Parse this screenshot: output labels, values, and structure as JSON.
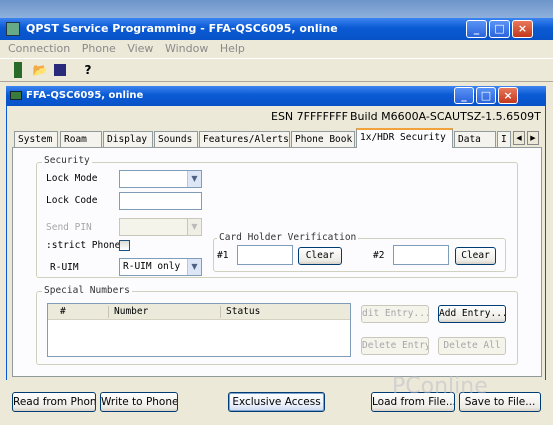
{
  "desktop": {
    "taskbar_text": ""
  },
  "window": {
    "title": "QPST Service Programming - FFA-QSC6095, online",
    "menu": [
      "Connection",
      "Phone",
      "View",
      "Window",
      "Help"
    ],
    "controls": [
      "_",
      "□",
      "×"
    ]
  },
  "inner": {
    "title": "FFA-QSC6095, online",
    "esn": "ESN 7FFFFFFF",
    "build": "Build M6600A-SCAUTSZ-1.5.6509T"
  },
  "tabs": [
    "System",
    "Roam",
    "Display",
    "Sounds",
    "Features/Alerts",
    "Phone Book",
    "1x/HDR Security",
    "Data",
    "I"
  ],
  "security": {
    "legend": "Security",
    "lock_mode_label": "Lock Mode",
    "lock_code_label": "Lock Code",
    "send_pin_label": "Send PIN",
    "restrict_phone_label": ":strict Phone",
    "ruim_label": "R-UIM",
    "ruim_value": "R-UIM only"
  },
  "card_holder": {
    "legend": "Card Holder Verification",
    "label1": "#1",
    "label2": "#2",
    "clear_label": "Clear"
  },
  "special_numbers": {
    "legend": "Special Numbers",
    "columns": [
      "#",
      "Number",
      "Status"
    ],
    "edit_label": "dit Entry...",
    "add_label": "Add Entry...",
    "delete_label": "Delete Entry",
    "delete_all_label": "Delete All"
  },
  "bottom": {
    "read": "Read from Phone",
    "write": "Write to Phone",
    "exclusive": "Exclusive Access",
    "load": "Load from File...",
    "save": "Save to File..."
  },
  "watermark": "PConline"
}
